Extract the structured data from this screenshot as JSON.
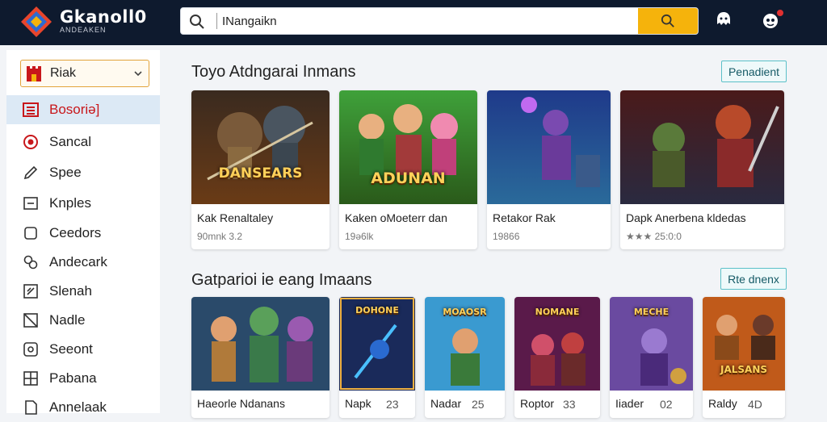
{
  "header": {
    "logo_title": "Gkanoll0",
    "logo_subtitle": "ANDEAKEN",
    "search_placeholder": "",
    "search_value": "INangaikn",
    "colors": {
      "bar": "#0e1a2e",
      "search_button": "#f5b30c"
    },
    "icons": [
      "search-icon",
      "user-icon",
      "notification-icon"
    ]
  },
  "sidebar": {
    "select_label": "Riak",
    "items": [
      {
        "label": "Bosoriə]",
        "icon": "list-icon",
        "active": true
      },
      {
        "label": "Sancal",
        "icon": "target-icon"
      },
      {
        "label": "Spee",
        "icon": "pencil-icon"
      },
      {
        "label": "Knples",
        "icon": "minus-box-icon"
      },
      {
        "label": "Ceedors",
        "icon": "square-icon"
      },
      {
        "label": "Andecark",
        "icon": "link-icon"
      },
      {
        "label": "Slenah",
        "icon": "slash-box-icon"
      },
      {
        "label": "Nadle",
        "icon": "diagonal-box-icon"
      },
      {
        "label": "Seeont",
        "icon": "circle-box-icon"
      },
      {
        "label": "Pabana",
        "icon": "grid-icon"
      },
      {
        "label": "Annelaak",
        "icon": "doc-icon"
      }
    ]
  },
  "sections": [
    {
      "title": "Toyo Atdngarai Inmans",
      "button": "Penadient",
      "cards": [
        {
          "title": "Kak Renaltaley",
          "meta": "90mnk  3.2",
          "art_text": "DANSEARS"
        },
        {
          "title": "Kaken oMoeterr dan",
          "meta": "19ə6lk",
          "art_text": "ADUNAN"
        },
        {
          "title": "Retakor Rak",
          "meta": "19866",
          "art_text": ""
        },
        {
          "title": "Dapk Anerbena kldedas",
          "meta": "★★★ 25:0:0",
          "art_text": ""
        }
      ]
    },
    {
      "title": "Gatparioi ie eang Imaans",
      "button": "Rte dnenx",
      "cards": [
        {
          "title": "Haeorle Ndanans",
          "meta": "",
          "art_text": ""
        },
        {
          "title": "Napk",
          "meta": "23",
          "art_text": "DOHONE"
        },
        {
          "title": "Nadar",
          "meta": "25",
          "art_text": "MOAOSR"
        },
        {
          "title": "Roptor",
          "meta": "33",
          "art_text": "NOMANE"
        },
        {
          "title": "Iiader",
          "meta": "02",
          "art_text": "MECHE"
        },
        {
          "title": "Raldy",
          "meta": "4D",
          "art_text": "JALSANS"
        }
      ]
    }
  ]
}
